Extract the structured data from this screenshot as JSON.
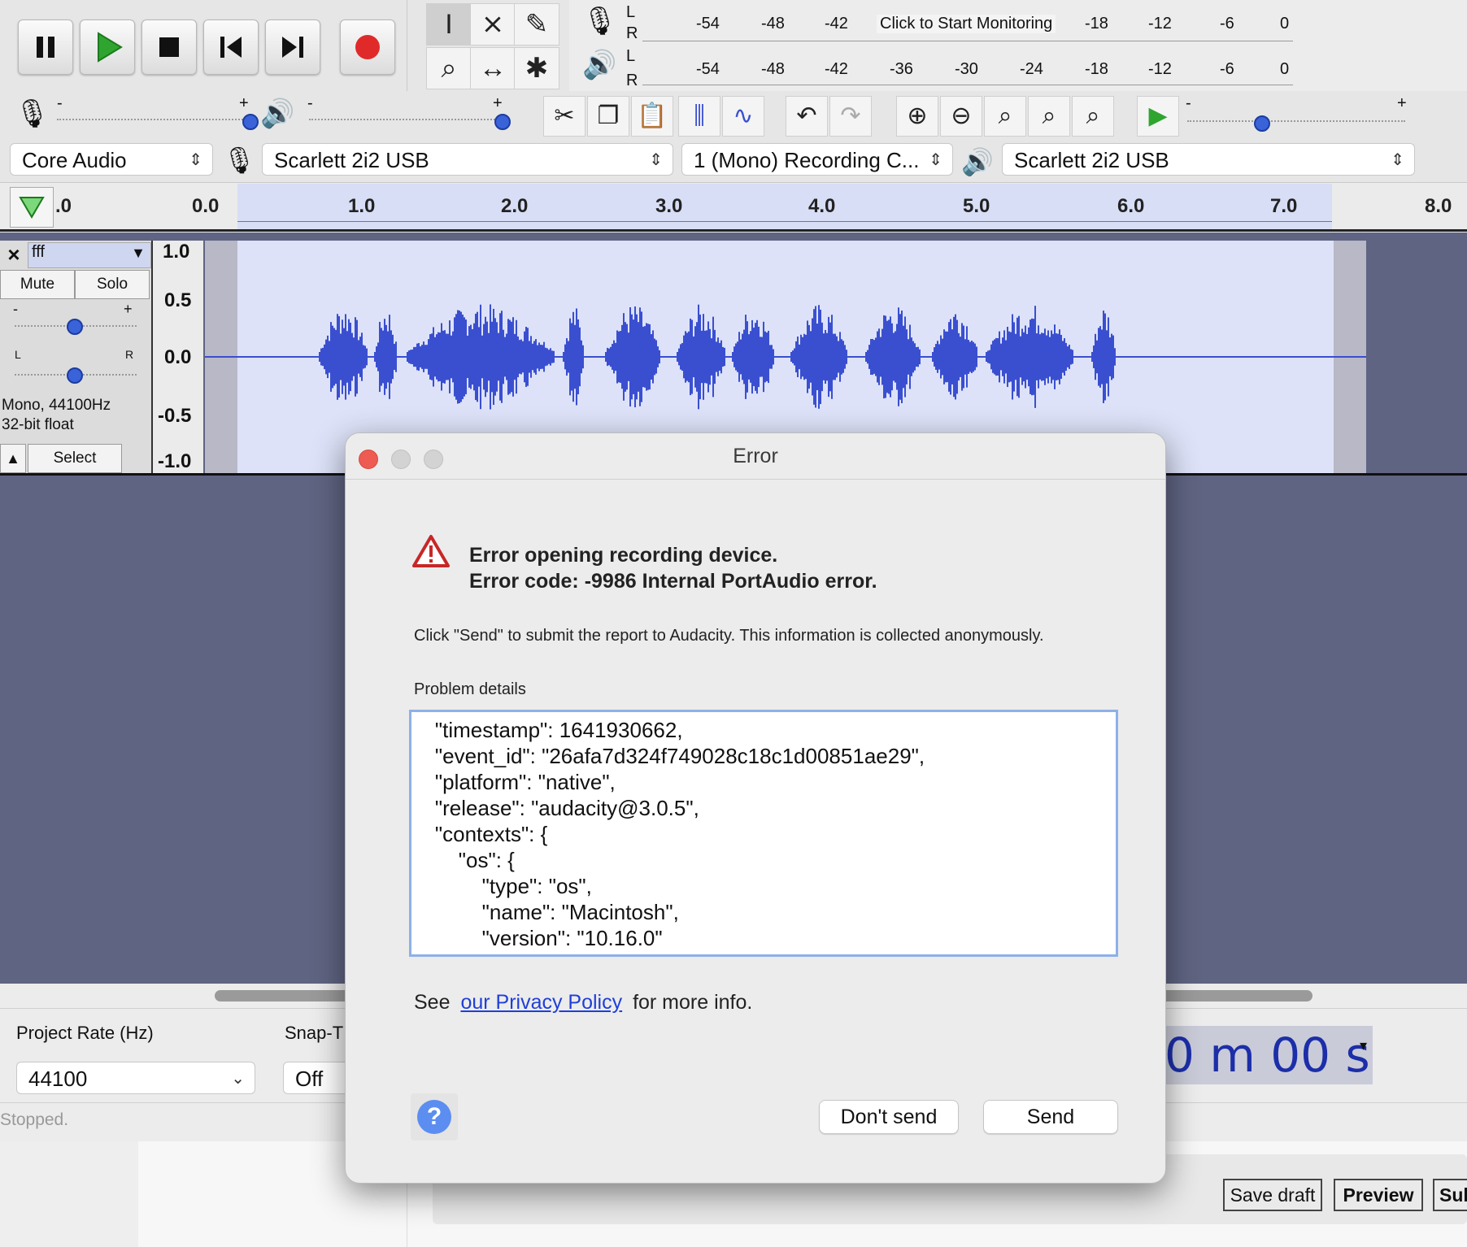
{
  "meter": {
    "ch_l": "L",
    "ch_r": "R",
    "record_scale": [
      "-54",
      "-48",
      "-42",
      "-18",
      "-12",
      "-6",
      "0"
    ],
    "record_prompt": "Click to Start Monitoring",
    "play_scale": [
      "-54",
      "-48",
      "-42",
      "-36",
      "-30",
      "-24",
      "-18",
      "-12",
      "-6",
      "0"
    ]
  },
  "mixer": {
    "plus": "+",
    "minus": "-"
  },
  "devices": {
    "host": "Core Audio",
    "recording_device": "Scarlett 2i2 USB",
    "channels": "1 (Mono) Recording C...",
    "playback_device": "Scarlett 2i2 USB"
  },
  "ruler": {
    "labels": [
      ".0",
      "0.0",
      "1.0",
      "2.0",
      "3.0",
      "4.0",
      "5.0",
      "6.0",
      "7.0",
      "8.0"
    ]
  },
  "track": {
    "close": "×",
    "name": "fff",
    "mute": "Mute",
    "solo": "Solo",
    "gain_minus": "-",
    "gain_plus": "+",
    "pan_l": "L",
    "pan_r": "R",
    "info_line1": "Mono, 44100Hz",
    "info_line2": "32-bit float",
    "select": "Select",
    "yaxis": [
      "1.0",
      "0.5",
      "0.0",
      "-0.5",
      "-1.0"
    ]
  },
  "bottom": {
    "project_rate_label": "Project Rate (Hz)",
    "project_rate_value": "44100",
    "snap_label": "Snap-T",
    "snap_value": "Off",
    "time_display": "0 m 00 s",
    "status": "Stopped."
  },
  "webpage": {
    "save_draft": "Save draft",
    "preview": "Preview",
    "submit_partial": "Sub"
  },
  "dialog": {
    "title": "Error",
    "heading_line1": "Error opening recording device.",
    "heading_line2": "Error code: -9986 Internal PortAudio error.",
    "info": "Click \"Send\" to submit the report to Audacity. This information is collected anonymously.",
    "details_label": "Problem details",
    "details_lines": [
      "    \"timestamp\": 1641930662,",
      "    \"event_id\": \"26afa7d324f749028c18c1d00851ae29\",",
      "    \"platform\": \"native\",",
      "    \"release\": \"audacity@3.0.5\",",
      "    \"contexts\": {",
      "        \"os\": {",
      "            \"type\": \"os\",",
      "            \"name\": \"Macintosh\",",
      "            \"version\": \"10.16.0\""
    ],
    "see_prefix": "See",
    "privacy_link": "our Privacy Policy",
    "see_suffix": "for more info.",
    "help": "?",
    "dont_send": "Don't send",
    "send": "Send"
  },
  "colors": {
    "waveform": "#3a4fd0",
    "track_bg": "#dde2f8",
    "project_bg": "#5f6482",
    "record": "#e02a2a",
    "play": "#2fa52f",
    "link": "#1f3fd8"
  }
}
